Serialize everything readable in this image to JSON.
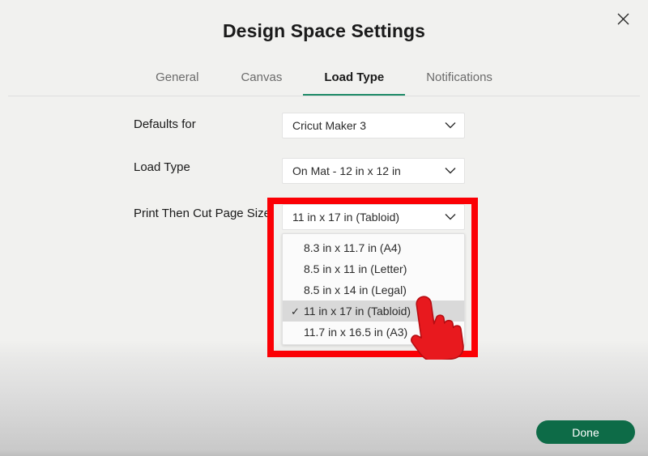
{
  "dialog": {
    "title": "Design Space Settings",
    "close_icon": "close-x-icon"
  },
  "tabs": [
    {
      "label": "General",
      "active": false
    },
    {
      "label": "Canvas",
      "active": false
    },
    {
      "label": "Load Type",
      "active": true
    },
    {
      "label": "Notifications",
      "active": false
    }
  ],
  "form": {
    "rows": [
      {
        "label": "Defaults for",
        "value": "Cricut Maker 3"
      },
      {
        "label": "Load Type",
        "value": "On Mat - 12 in x 12 in"
      },
      {
        "label": "Print Then Cut Page Size",
        "value": "11 in x 17 in (Tabloid)"
      }
    ]
  },
  "dropdown": {
    "open": true,
    "selected": "11 in x 17 in (Tabloid)",
    "check_glyph": "✓",
    "options": [
      {
        "label": "8.3 in x 11.7 in (A4)",
        "selected": false
      },
      {
        "label": "8.5 in x 11 in (Letter)",
        "selected": false
      },
      {
        "label": "8.5 in x 14 in (Legal)",
        "selected": false
      },
      {
        "label": "11 in x 17 in (Tabloid)",
        "selected": true
      },
      {
        "label": "11.7 in x 16.5 in (A3)",
        "selected": false
      }
    ]
  },
  "highlight": {
    "color": "#fb0005",
    "target": "print-then-cut-page-size-dropdown"
  },
  "cursor": {
    "icon": "pointing-hand-cursor",
    "color": "#e8191e"
  },
  "footer": {
    "done_label": "Done",
    "done_color": "#0d6b47"
  },
  "theme": {
    "background": "#f1f1ef",
    "accent_green": "#1d8a67",
    "text_primary": "#1a1a1a",
    "text_muted": "#6b6b6b"
  }
}
